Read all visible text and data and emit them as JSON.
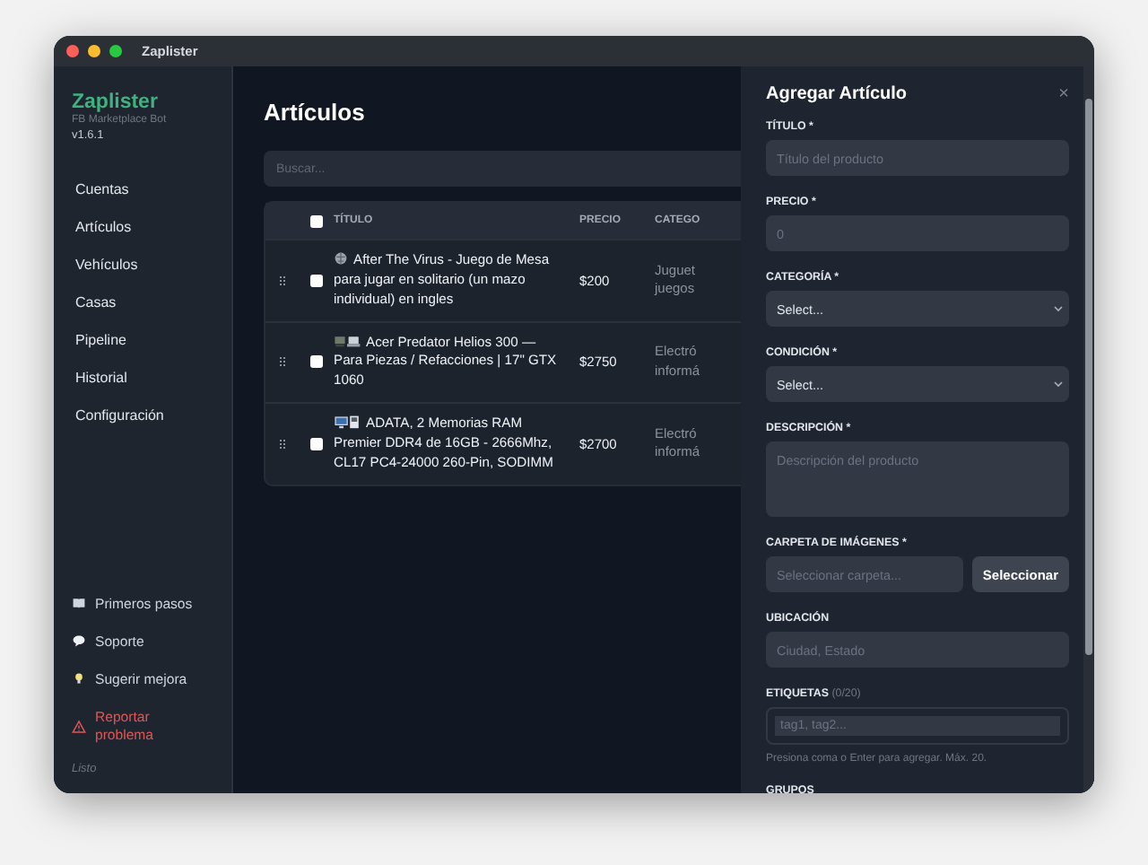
{
  "window": {
    "title": "Zaplister"
  },
  "sidebar": {
    "app_name": "Zaplister",
    "subtitle": "FB Marketplace Bot",
    "version": "v1.6.1",
    "nav": [
      {
        "label": "Cuentas",
        "selected": false
      },
      {
        "label": "Artículos",
        "selected": false
      },
      {
        "label": "Vehículos",
        "selected": false
      },
      {
        "label": "Casas",
        "selected": false
      },
      {
        "label": "Pipeline",
        "selected": false
      },
      {
        "label": "Historial",
        "selected": false
      },
      {
        "label": "Configuración",
        "selected": false
      }
    ],
    "footer_items": [
      {
        "label": "Primeros pasos",
        "kind": "book"
      },
      {
        "label": "Soporte",
        "kind": "chat"
      },
      {
        "label": "Sugerir mejora",
        "kind": "bulb"
      },
      {
        "label": "Reportar problema",
        "kind": "warning"
      }
    ],
    "status": "Listo"
  },
  "main": {
    "title": "Artículos",
    "search_placeholder": "Buscar...",
    "table": {
      "select_all_checked": false,
      "columns": [
        "TÍTULO",
        "PRECIO",
        "CATEGO"
      ],
      "rows": [
        {
          "kind": "game",
          "title": "After The Virus - Juego de Mesa para jugar en solitario (un mazo individual) en ingles",
          "price": "$200",
          "category": [
            "Juguet",
            "juegos"
          ],
          "checked": false
        },
        {
          "kind": "laptop",
          "title": "Acer Predator Helios 300 — Para Piezas / Refacciones | 17\" GTX 1060",
          "price": "$2750",
          "category": [
            "Electró",
            "informá"
          ],
          "checked": false
        },
        {
          "kind": "desktop",
          "title": "ADATA, 2 Memorias RAM Premier DDR4 de 16GB - 2666Mhz, CL17 PC4-24000 260-Pin, SODIMM",
          "price": "$2700",
          "category": [
            "Electró",
            "informá"
          ],
          "checked": false
        }
      ]
    }
  },
  "panel": {
    "title": "Agregar Artículo",
    "close": "×",
    "fields": [
      {
        "kind": "input",
        "label": "TÍTULO *",
        "placeholder": "Título del producto"
      },
      {
        "kind": "input",
        "label": "PRECIO *",
        "placeholder": "0"
      },
      {
        "kind": "select",
        "label": "CATEGORÍA *",
        "value": "Select..."
      },
      {
        "kind": "select",
        "label": "CONDICIÓN *",
        "value": "Select..."
      },
      {
        "kind": "textarea",
        "label": "DESCRIPCIÓN *",
        "placeholder": "Descripción del producto"
      },
      {
        "kind": "folder",
        "label": "CARPETA DE IMÁGENES *",
        "placeholder": "Seleccionar carpeta...",
        "button": "Seleccionar"
      },
      {
        "kind": "input",
        "label": "UBICACIÓN",
        "placeholder": "Ciudad, Estado"
      },
      {
        "kind": "tags",
        "label": "ETIQUETAS",
        "counter": "(0/20)",
        "placeholder": "tag1, tag2...",
        "hint": "Presiona coma o Enter para agregar. Máx. 20."
      },
      {
        "kind": "cut",
        "label": "GRUPOS"
      }
    ]
  }
}
